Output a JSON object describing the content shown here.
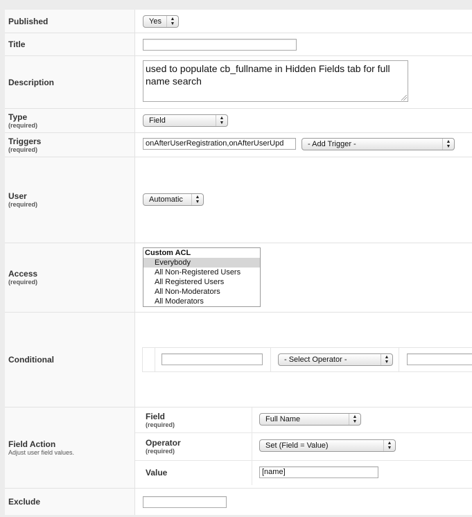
{
  "published": {
    "label": "Published",
    "value": "Yes"
  },
  "title_field": {
    "label": "Title",
    "value": ""
  },
  "description": {
    "label": "Description",
    "value": "used to populate cb_fullname in Hidden Fields tab for full name search"
  },
  "type": {
    "label": "Type",
    "required": "(required)",
    "value": "Field"
  },
  "triggers": {
    "label": "Triggers",
    "required": "(required)",
    "value": "onAfterUserRegistration,onAfterUserUpd",
    "add_trigger": "- Add Trigger -"
  },
  "user": {
    "label": "User",
    "required": "(required)",
    "value": "Automatic"
  },
  "access": {
    "label": "Access",
    "required": "(required)",
    "group_label": "Custom ACL",
    "options": [
      "Everybody",
      "All Non-Registered Users",
      "All Registered Users",
      "All Non-Moderators",
      "All Moderators"
    ],
    "selected": "Everybody"
  },
  "conditional": {
    "label": "Conditional",
    "field_value": "",
    "operator": "- Select Operator -",
    "value": ""
  },
  "field_action": {
    "label": "Field Action",
    "hint": "Adjust user field values.",
    "field": {
      "label": "Field",
      "required": "(required)",
      "value": "Full Name"
    },
    "operator": {
      "label": "Operator",
      "required": "(required)",
      "value": "Set (Field = Value)"
    },
    "value": {
      "label": "Value",
      "value": "[name]"
    }
  },
  "exclude": {
    "label": "Exclude",
    "value": ""
  }
}
